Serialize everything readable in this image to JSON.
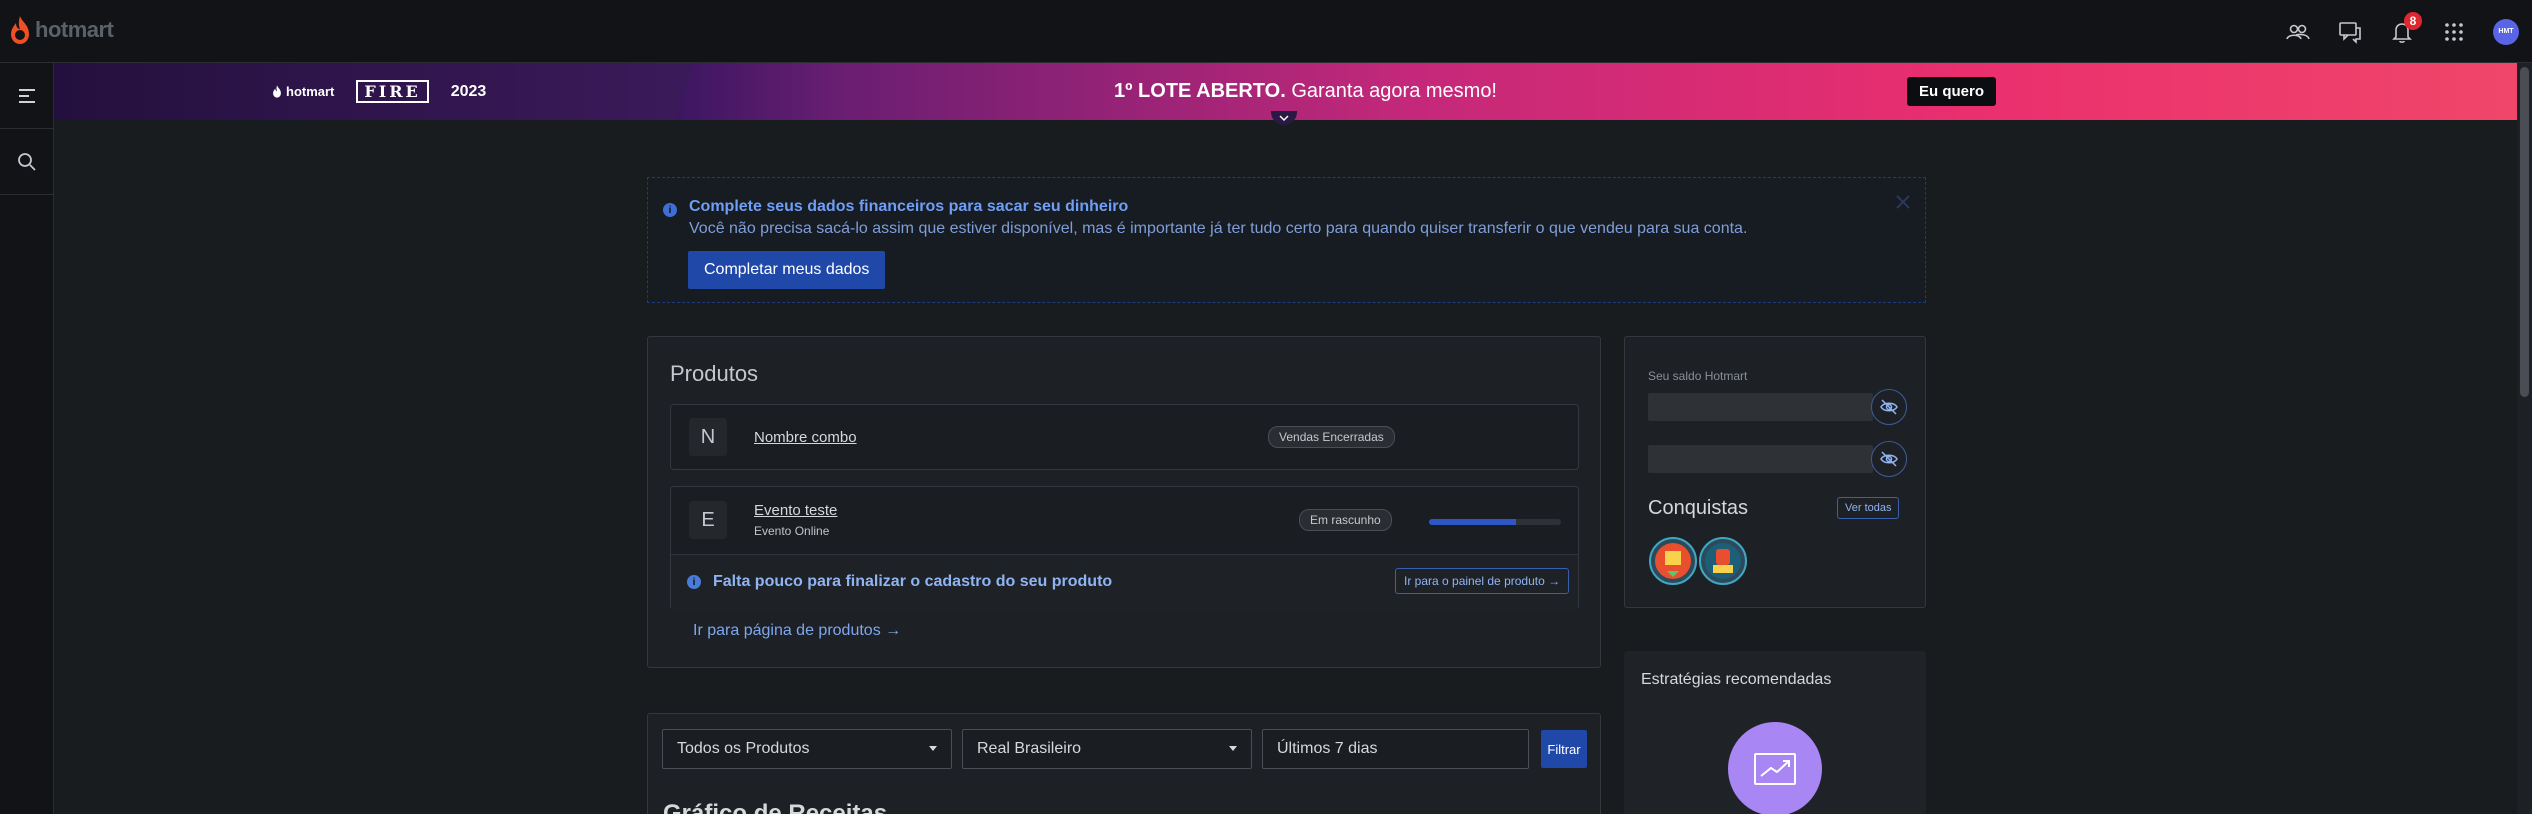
{
  "brand": {
    "name": "hotmart"
  },
  "topbar": {
    "notifications_count": "8",
    "avatar_initials": "HMT"
  },
  "banner": {
    "brand_label": "hotmart",
    "event_logo": "FIRE",
    "event_year": "2023",
    "headline_bold": "1º LOTE ABERTO.",
    "headline_rest": " Garanta agora mesmo!",
    "cta": "Eu quero"
  },
  "alert": {
    "title": "Complete seus dados financeiros para sacar seu dinheiro",
    "text": "Você não precisa sacá-lo assim que estiver disponível, mas é importante já ter tudo certo para quando quiser transferir o que vendeu para sua conta.",
    "button": "Completar meus dados"
  },
  "products": {
    "title": "Produtos",
    "items": [
      {
        "letter": "N",
        "name": "Nombre combo",
        "status": "Vendas Encerradas"
      },
      {
        "letter": "E",
        "name": "Evento teste",
        "subtitle": "Evento Online",
        "status": "Em rascunho",
        "progress": 0.66
      }
    ],
    "warning": "Falta pouco para finalizar o cadastro do seu produto",
    "warning_link": "Ir para o painel de produto",
    "page_link": "Ir para página de produtos"
  },
  "saldo": {
    "label": "Seu saldo Hotmart",
    "conquistas_title": "Conquistas",
    "ver_todas": "Ver todas"
  },
  "estrategias": {
    "title": "Estratégias recomendadas"
  },
  "filters": {
    "products_select": "Todos os Produtos",
    "currency_select": "Real Brasileiro",
    "period": "Últimos 7 dias",
    "button": "Filtrar",
    "chart_title": "Gráfico de Receitas"
  },
  "colors": {
    "accent": "#1f48a8",
    "brand": "#f04e23",
    "notification": "#e0262f"
  }
}
